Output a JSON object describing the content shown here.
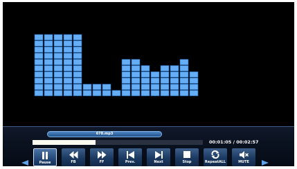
{
  "player": {
    "file_name": "678.mp3",
    "time_current": "00:01:05",
    "time_total": "00:02:57",
    "time_separator": " / ",
    "progress_fraction": 0.37
  },
  "visualizer": {
    "bar_levels": [
      10,
      10,
      10,
      10,
      10,
      2,
      2,
      2,
      1,
      6,
      6,
      5,
      4,
      5,
      5,
      6,
      4
    ],
    "block_color": "#65aef6",
    "block_border_color": "#1e63b3"
  },
  "controls": [
    {
      "id": "pause",
      "label": "Pause",
      "icon": "pause-icon"
    },
    {
      "id": "fb",
      "label": "FB",
      "icon": "fast-backward-icon"
    },
    {
      "id": "ff",
      "label": "FF",
      "icon": "fast-forward-icon"
    },
    {
      "id": "prev",
      "label": "Prev.",
      "icon": "skip-previous-icon"
    },
    {
      "id": "next",
      "label": "Next",
      "icon": "skip-next-icon"
    },
    {
      "id": "stop",
      "label": "Stop",
      "icon": "stop-icon"
    },
    {
      "id": "repeat",
      "label": "RepeatALL",
      "icon": "repeat-icon"
    },
    {
      "id": "mute",
      "label": "MUTE",
      "icon": "mute-icon"
    }
  ],
  "selected_control": "pause",
  "colors": {
    "screen_background": "#000000",
    "panel_accent": "#4f86c2",
    "button_face": "#1c3a61",
    "progress_fill": "#fbfbf2",
    "text": "#ffffff"
  }
}
